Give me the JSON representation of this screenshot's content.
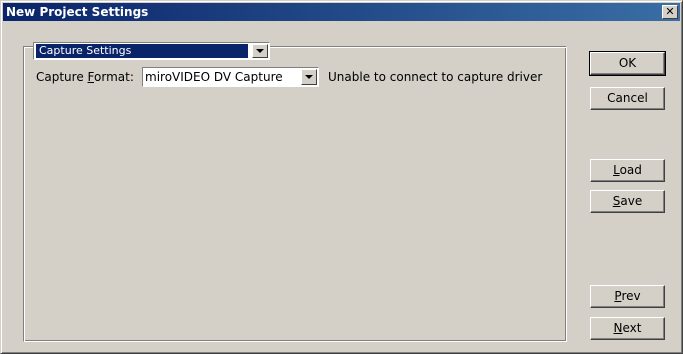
{
  "window": {
    "title": "New Project Settings",
    "close_glyph": "✕"
  },
  "section_select": {
    "value": "Capture Settings"
  },
  "capture_format": {
    "label_before": "Capture ",
    "label_accel": "F",
    "label_after": "ormat:",
    "value": "miroVIDEO DV Capture",
    "status": "Unable to connect to capture driver"
  },
  "buttons": {
    "ok": "OK",
    "cancel": "Cancel",
    "load": {
      "accel": "L",
      "rest": "oad"
    },
    "save": {
      "accel": "S",
      "rest": "ave"
    },
    "prev": {
      "accel": "P",
      "rest": "rev"
    },
    "next": {
      "accel": "N",
      "rest": "ext"
    }
  }
}
